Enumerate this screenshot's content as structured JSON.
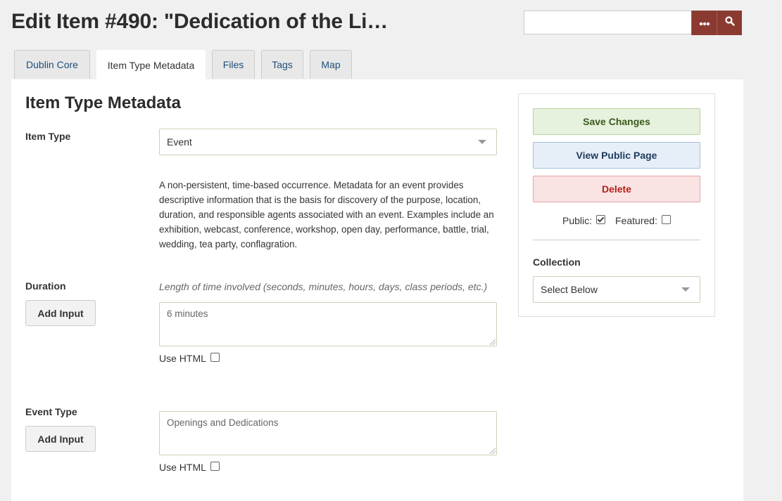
{
  "header": {
    "title": "Edit Item #490: \"Dedication of the Li…"
  },
  "search": {
    "value": "",
    "options_icon": "ellipsis-icon",
    "submit_icon": "search-icon"
  },
  "tabs": [
    {
      "label": "Dublin Core"
    },
    {
      "label": "Item Type Metadata"
    },
    {
      "label": "Files"
    },
    {
      "label": "Tags"
    },
    {
      "label": "Map"
    }
  ],
  "main": {
    "section_title": "Item Type Metadata",
    "item_type": {
      "label": "Item Type",
      "value": "Event"
    },
    "description": "A non-persistent, time-based occurrence. Metadata for an event provides descriptive information that is the basis for discovery of the purpose, location, duration, and responsible agents associated with an event. Examples include an exhibition, webcast, conference, workshop, open day, performance, battle, trial, wedding, tea party, conflagration.",
    "duration": {
      "label": "Duration",
      "hint": "Length of time involved (seconds, minutes, hours, days, class periods, etc.)",
      "value": "6 minutes",
      "add_input": "Add Input",
      "use_html": "Use HTML"
    },
    "event_type": {
      "label": "Event Type",
      "value": "Openings and Dedications",
      "add_input": "Add Input",
      "use_html": "Use HTML"
    }
  },
  "sidebar": {
    "save": "Save Changes",
    "view": "View Public Page",
    "delete": "Delete",
    "public_label": "Public:",
    "public_checked": true,
    "featured_label": "Featured:",
    "featured_checked": false,
    "collection_label": "Collection",
    "collection_value": "Select Below"
  },
  "colors": {
    "accent": "#8b3a31",
    "save_bg": "#e6f2dd",
    "view_bg": "#e6eef8",
    "delete_bg": "#f9e3e3",
    "delete_text": "#b3221a"
  }
}
